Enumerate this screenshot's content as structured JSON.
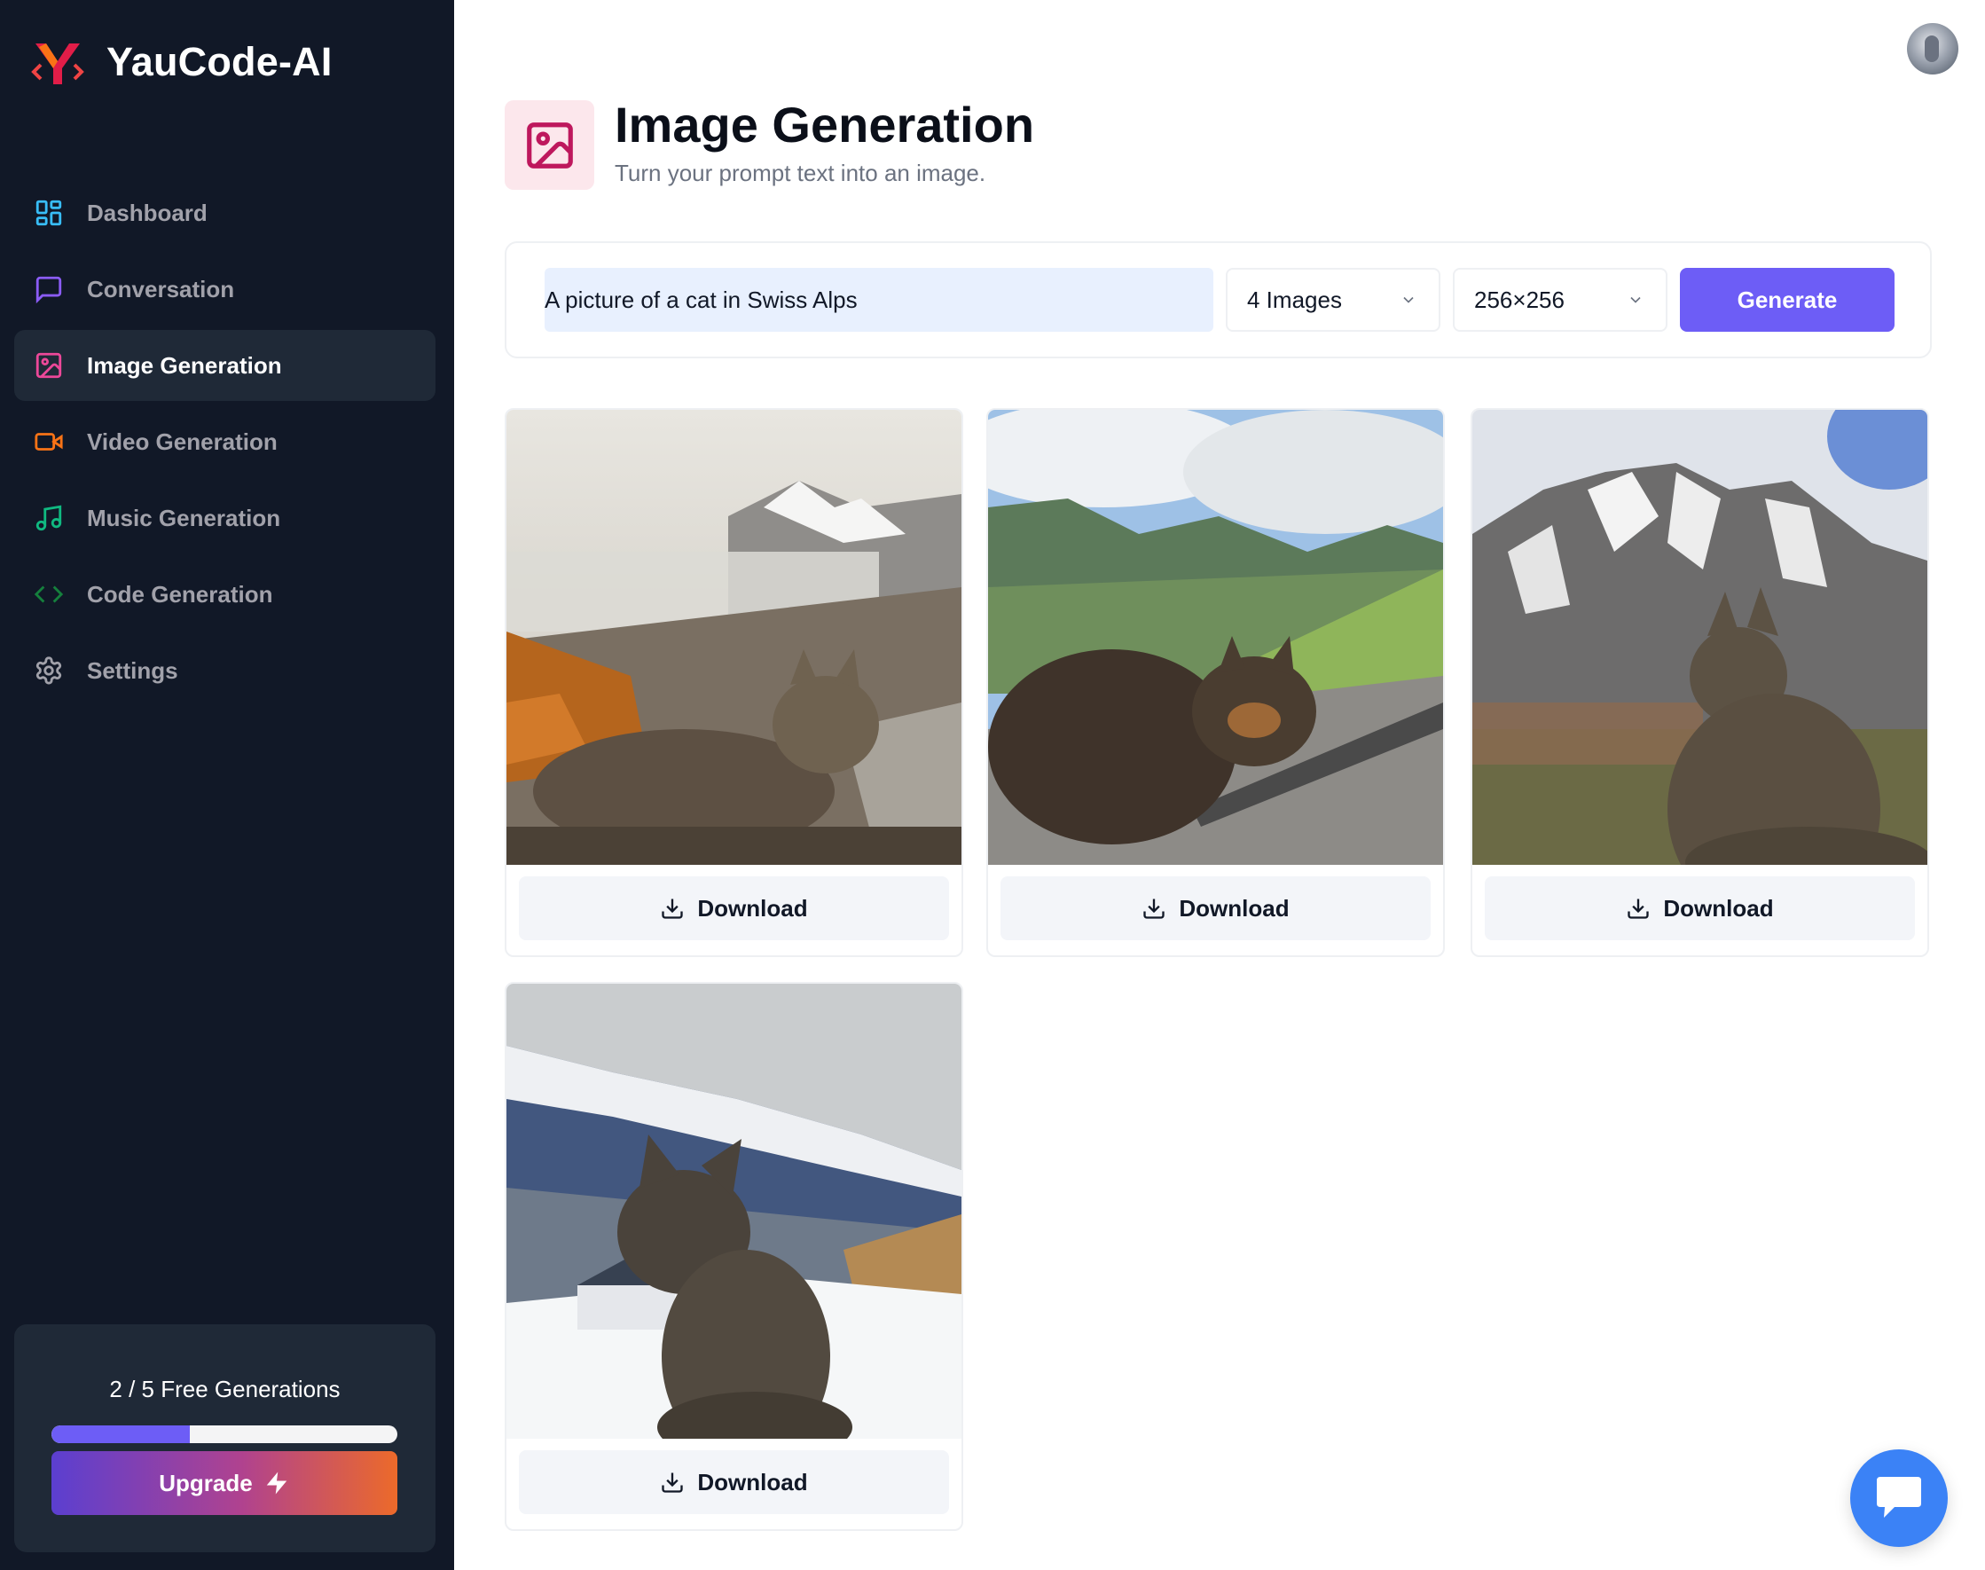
{
  "app": {
    "name": "YauCode-AI"
  },
  "sidebar": {
    "items": [
      {
        "label": "Dashboard",
        "icon": "dashboard-icon",
        "color": "#38bdf8"
      },
      {
        "label": "Conversation",
        "icon": "message-square-icon",
        "color": "#8b5cf6"
      },
      {
        "label": "Image Generation",
        "icon": "image-icon",
        "color": "#ec4899",
        "active": true
      },
      {
        "label": "Video Generation",
        "icon": "video-icon",
        "color": "#f97316"
      },
      {
        "label": "Music Generation",
        "icon": "music-icon",
        "color": "#10b981"
      },
      {
        "label": "Code Generation",
        "icon": "code-icon",
        "color": "#15803d"
      },
      {
        "label": "Settings",
        "icon": "gear-icon",
        "color": "#a1a1aa"
      }
    ],
    "free_counter": {
      "text": "2 / 5 Free Generations",
      "used": 2,
      "limit": 5
    },
    "upgrade_label": "Upgrade"
  },
  "header": {
    "title": "Image Generation",
    "subtitle": "Turn your prompt text into an image.",
    "icon": "image-icon",
    "accent": "#be185d"
  },
  "form": {
    "prompt_value": "A picture of a cat in Swiss Alps",
    "amount": "4 Images",
    "resolution": "256×256",
    "generate_label": "Generate"
  },
  "images": [
    {
      "download_label": "Download"
    },
    {
      "download_label": "Download"
    },
    {
      "download_label": "Download"
    },
    {
      "download_label": "Download"
    }
  ],
  "colors": {
    "sidebar_bg": "#111827",
    "primary": "#6d5df6",
    "chat_button": "#3b82f6"
  }
}
